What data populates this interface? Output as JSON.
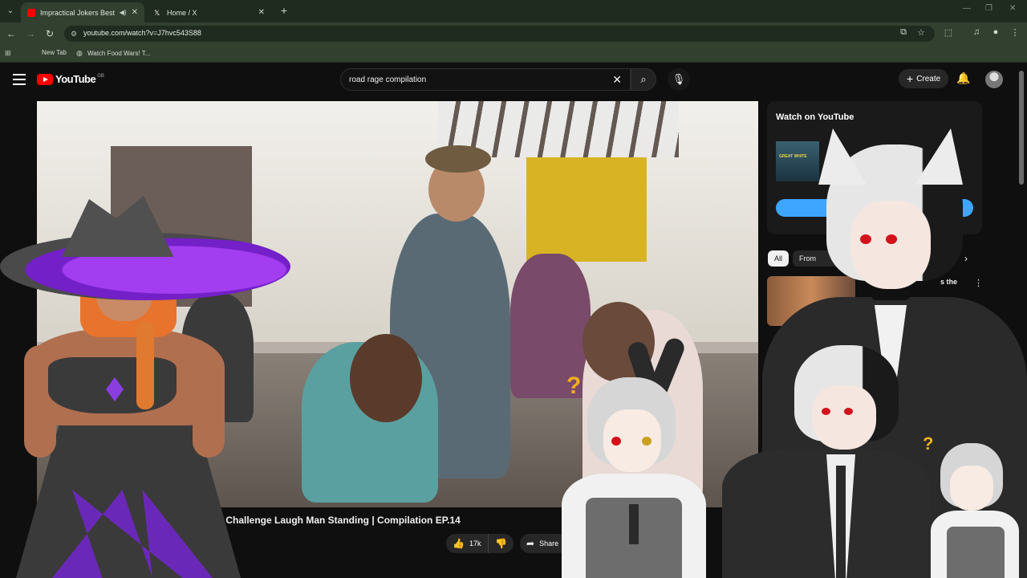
{
  "browser": {
    "tabs": [
      {
        "label": "Impractical Jokers Best Pun",
        "active": true,
        "audio": true
      },
      {
        "label": "Home / X",
        "active": false,
        "audio": false
      }
    ],
    "url": "youtube.com/watch?v=J7hvc543S88",
    "bookmarks": [
      {
        "label": "New Tab"
      },
      {
        "label": "Watch Food Wars! T..."
      }
    ]
  },
  "youtube": {
    "logo_text": "YouTube",
    "country_code": "GB",
    "search_query": "road rage compilation",
    "create_label": "Create"
  },
  "video": {
    "title_visible": "s - Challenge Laugh Man Standing | Compilation EP.14",
    "likes": "17k",
    "share_label": "Share"
  },
  "sidebar": {
    "watch_card_title": "Watch on YouTube",
    "watch_card_thumb_text": "GREAT WHITE",
    "chips": [
      {
        "label": "All",
        "active": true
      },
      {
        "label": "From The...",
        "active": false
      }
    ],
    "rec_title_fragment": "s the"
  },
  "colors": {
    "yt_red": "#ff0000",
    "accent_blue": "#3ea6ff",
    "browser_green": "#32402f"
  }
}
